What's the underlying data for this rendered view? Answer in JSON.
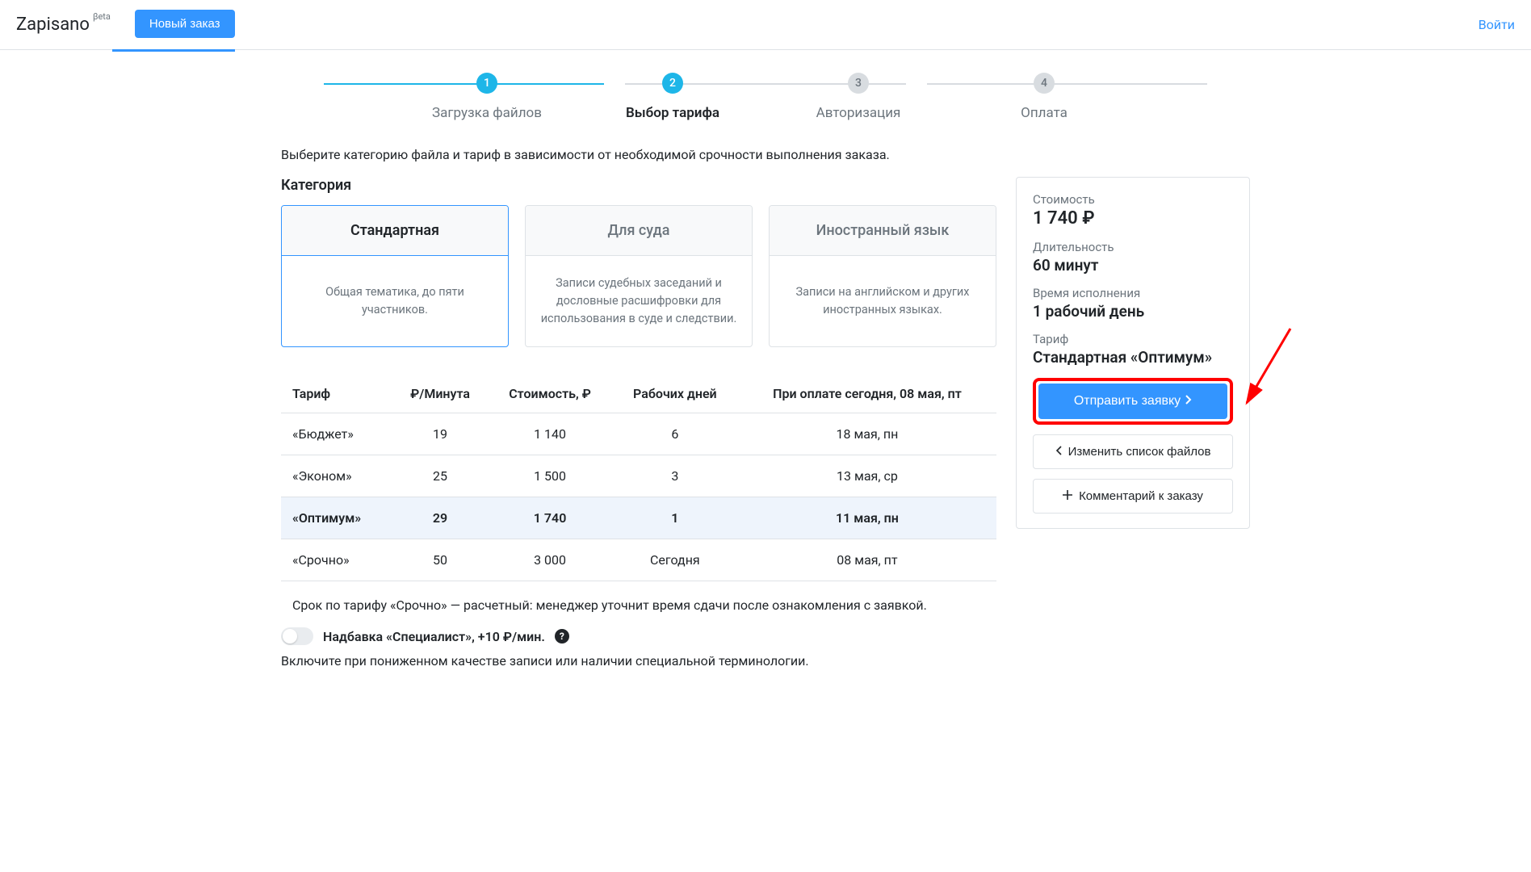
{
  "header": {
    "logo": "Zapisano",
    "beta": "βeta",
    "new_order": "Новый заказ",
    "login": "Войти"
  },
  "steps": [
    {
      "num": "1",
      "label": "Загрузка файлов",
      "state": "done"
    },
    {
      "num": "2",
      "label": "Выбор тарифа",
      "state": "active"
    },
    {
      "num": "3",
      "label": "Авторизация",
      "state": "pending"
    },
    {
      "num": "4",
      "label": "Оплата",
      "state": "pending"
    }
  ],
  "instruction": "Выберите категорию файла и тариф в зависимости от необходимой срочности выполнения заказа.",
  "category_title": "Категория",
  "categories": [
    {
      "title": "Стандартная",
      "desc": "Общая тематика, до пяти участников.",
      "selected": true
    },
    {
      "title": "Для суда",
      "desc": "Записи судебных заседаний и дословные расшифровки для использования в суде и следствии."
    },
    {
      "title": "Иностранный язык",
      "desc": "Записи на английском и других иностранных языках."
    }
  ],
  "tariff_title": "Тариф",
  "tariff_headers": {
    "name": "Тариф",
    "per_min": "₽/Минута",
    "cost": "Стоимость, ₽",
    "days": "Рабочих дней",
    "ready": "При оплате сегодня, 08 мая, пт"
  },
  "tariffs": [
    {
      "name": "«Бюджет»",
      "per_min": "19",
      "cost": "1 140",
      "days": "6",
      "ready": "18 мая, пн"
    },
    {
      "name": "«Эконом»",
      "per_min": "25",
      "cost": "1 500",
      "days": "3",
      "ready": "13 мая, ср"
    },
    {
      "name": "«Оптимум»",
      "per_min": "29",
      "cost": "1 740",
      "days": "1",
      "ready": "11 мая, пн",
      "selected": true
    },
    {
      "name": "«Срочно»",
      "per_min": "50",
      "cost": "3 000",
      "days": "Сегодня",
      "ready": "08 мая, пт"
    }
  ],
  "urgent_note": "Срок по тарифу «Срочно»  — расчетный: менеджер уточнит время сдачи после ознакомления с заявкой.",
  "specialist": {
    "label": "Надбавка «Специалист», +10 ₽/мин.",
    "desc": "Включите при пониженном качестве записи или наличии специальной терминологии."
  },
  "sidebar": {
    "cost_label": "Стоимость",
    "cost_value": "1 740 ₽",
    "duration_label": "Длительность",
    "duration_value": "60 минут",
    "eta_label": "Время исполнения",
    "eta_value": "1 рабочий день",
    "tariff_label": "Тариф",
    "tariff_value": "Стандартная «Оптимум»",
    "submit": "Отправить заявку",
    "change_files": "Изменить список файлов",
    "add_comment": "Комментарий к заказу"
  }
}
